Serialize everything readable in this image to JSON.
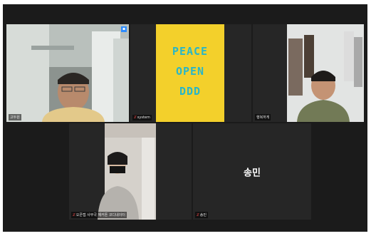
{
  "participants": [
    {
      "id": "p1",
      "name": "고두원",
      "muted": false,
      "active": true,
      "video": true
    },
    {
      "id": "p2",
      "name": "system",
      "muted": true,
      "active": false,
      "video": true
    },
    {
      "id": "p3",
      "name": "행복하게",
      "muted": false,
      "active": false,
      "video": true
    },
    {
      "id": "p4",
      "name": "오픈랩 사무국 해커톤 코디네이터",
      "muted": true,
      "active": false,
      "video": true
    },
    {
      "id": "p5",
      "name": "송민",
      "muted": true,
      "active": false,
      "video": false
    }
  ],
  "poster": {
    "text": "PEACE OPEN DDD"
  },
  "icons": {
    "mic_off": "mic-off-icon",
    "pin": "pin-icon"
  },
  "colors": {
    "active_border": "#c9d94a",
    "mic_off": "#ff4b4b",
    "poster_bg": "#f3d02b",
    "poster_fg": "#29b6c8"
  }
}
